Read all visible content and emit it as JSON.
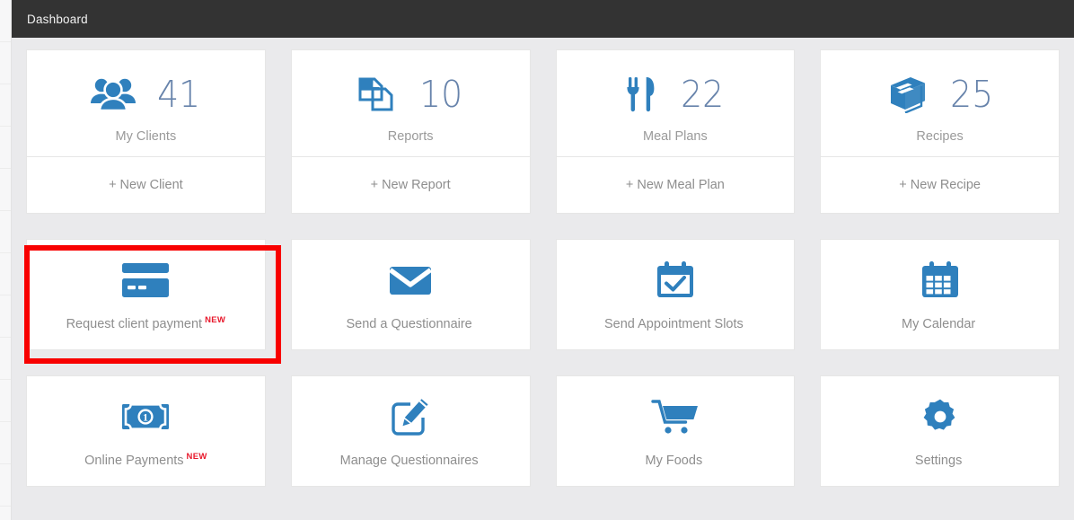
{
  "header": {
    "title": "Dashboard"
  },
  "colors": {
    "accent_blue": "#2f80bd",
    "stat_number": "#6783ab",
    "topbar": "#333333",
    "page_background": "#eaeaec",
    "label_gray": "#8e8e8e",
    "highlight_red": "#f80000",
    "new_badge_red": "#e8192c"
  },
  "stats": [
    {
      "icon": "users-icon",
      "count": "41",
      "label": "My Clients",
      "action": "+ New Client"
    },
    {
      "icon": "documents-icon",
      "count": "10",
      "label": "Reports",
      "action": "+ New Report"
    },
    {
      "icon": "cutlery-icon",
      "count": "22",
      "label": "Meal Plans",
      "action": "+ New Meal Plan"
    },
    {
      "icon": "book-icon",
      "count": "25",
      "label": "Recipes",
      "action": "+ New Recipe"
    }
  ],
  "actions_row_1": [
    {
      "icon": "credit-card-icon",
      "label": "Request client payment",
      "badge": "NEW",
      "highlighted": true
    },
    {
      "icon": "envelope-icon",
      "label": "Send a Questionnaire",
      "badge": ""
    },
    {
      "icon": "calendar-check-icon",
      "label": "Send Appointment Slots",
      "badge": ""
    },
    {
      "icon": "calendar-grid-icon",
      "label": "My Calendar",
      "badge": ""
    }
  ],
  "actions_row_2": [
    {
      "icon": "banknote-icon",
      "label": "Online Payments",
      "badge": "NEW"
    },
    {
      "icon": "edit-square-icon",
      "label": "Manage Questionnaires",
      "badge": ""
    },
    {
      "icon": "shopping-cart-icon",
      "label": "My Foods",
      "badge": ""
    },
    {
      "icon": "gear-icon",
      "label": "Settings",
      "badge": ""
    }
  ]
}
